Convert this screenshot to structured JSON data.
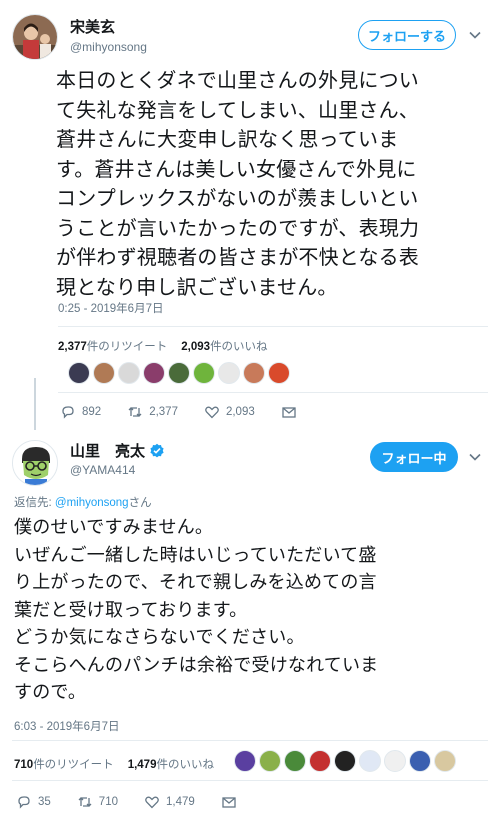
{
  "tweet1": {
    "display_name": "宋美玄",
    "handle": "@mihyonsong",
    "follow_label": "フォローする",
    "text_lines": [
      "本日のとくダネで山里さんの外見につい",
      "て失礼な発言をしてしまい、山里さん、",
      "蒼井さんに大変申し訳なく思っていま",
      "す。蒼井さんは美しい女優さんで外見に",
      "コンプレックスがないのが羨ましいとい",
      "うことが言いたかったのですが、表現力",
      "が伴わず視聴者の皆さまが不快となる表",
      "現となり申し訳ございません。"
    ],
    "timestamp": "0:25 - 2019年6月7日",
    "retweet_count": "2,377",
    "retweet_label": "件のリツイート",
    "like_count": "2,093",
    "like_label": "件のいいね",
    "action_reply": "892",
    "action_retweet": "2,377",
    "action_like": "2,093",
    "liker_colors": [
      "#3b3b52",
      "#b07a55",
      "#d9d9d9",
      "#8a3d6b",
      "#4a6b3a",
      "#6fb43c",
      "#e8e8e8",
      "#c87a5a",
      "#d94a2b"
    ]
  },
  "tweet2": {
    "display_name": "山里　亮太",
    "handle": "@YAMA414",
    "follow_label": "フォロー中",
    "reply_to_prefix": "返信先: ",
    "reply_to_handle": "@mihyonsong",
    "reply_to_suffix": "さん",
    "text_lines": [
      "僕のせいですみません。",
      "いぜんご一緒した時はいじっていただいて盛",
      "り上がったので、それで親しみを込めての言",
      "葉だと受け取っております。",
      "どうか気になさらないでください。",
      "そこらへんのパンチは余裕で受けなれていま",
      "すので。"
    ],
    "timestamp": "6:03 - 2019年6月7日",
    "retweet_count": "710",
    "retweet_label": "件のリツイート",
    "like_count": "1,479",
    "like_label": "件のいいね",
    "action_reply": "35",
    "action_retweet": "710",
    "action_like": "1,479",
    "liker_colors": [
      "#5a3fa0",
      "#8ab04a",
      "#4a8a3a",
      "#c43030",
      "#222222",
      "#e0e8f5",
      "#f0f0f0",
      "#3a5fb0",
      "#d8c8a0"
    ]
  },
  "colors": {
    "accent": "#1da1f2",
    "text": "#14171a",
    "muted": "#657786",
    "border": "#e6ecf0",
    "verified": "#1da1f2"
  }
}
